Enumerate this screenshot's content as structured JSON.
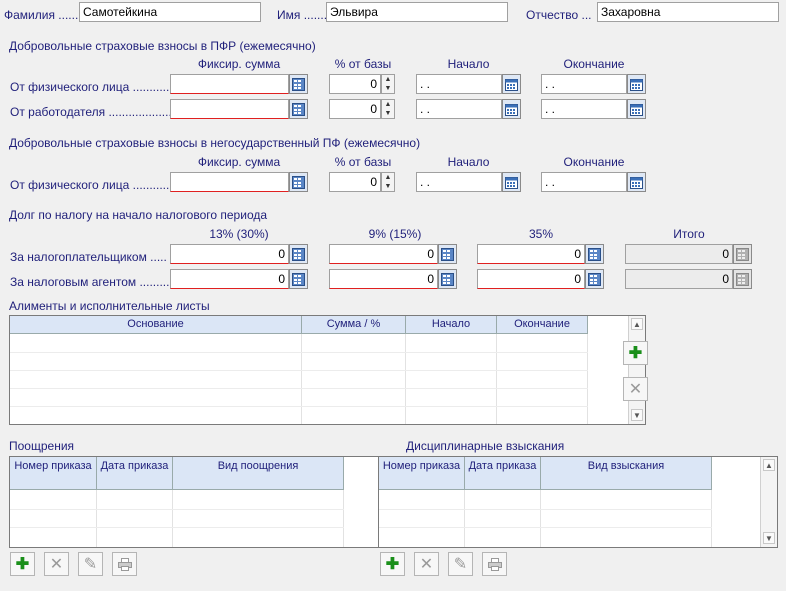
{
  "person": {
    "surname_label": "Фамилия",
    "surname_value": "Самотейкина",
    "name_label": "Имя",
    "name_value": "Эльвира",
    "patronymic_label": "Отчество",
    "patronymic_value": "Захаровна"
  },
  "pfr": {
    "title": "Добровольные страховые взносы в ПФР (ежемесячно)",
    "col_fixed": "Фиксир. сумма",
    "col_percent": "% от базы",
    "col_start": "Начало",
    "col_end": "Окончание",
    "row1_label": "От физического лица",
    "row2_label": "От работодателя",
    "row1_percent": "0",
    "row2_percent": "0",
    "date_placeholder": " .  ."
  },
  "npf": {
    "title": "Добровольные страховые взносы в негосударственный ПФ (ежемесячно)",
    "col_fixed": "Фиксир. сумма",
    "col_percent": "% от базы",
    "col_start": "Начало",
    "col_end": "Окончание",
    "row1_label": "От физического лица",
    "row1_percent": "0",
    "date_placeholder": " .  ."
  },
  "debt": {
    "title": "Долг по налогу на начало налогового периода",
    "col1": "13% (30%)",
    "col2": "9% (15%)",
    "col3": "35%",
    "col4": "Итого",
    "row1_label": "За налогоплательщиком",
    "row2_label": "За налоговым агентом",
    "row1_values": [
      "0",
      "0",
      "0",
      "0"
    ],
    "row2_values": [
      "0",
      "0",
      "0",
      "0"
    ]
  },
  "alimony": {
    "title": "Алименты и исполнительные листы",
    "columns": [
      "Основание",
      "Сумма / %",
      "Начало",
      "Окончание"
    ]
  },
  "rewards": {
    "title": "Поощрения",
    "columns": [
      "Номер приказа",
      "Дата приказа",
      "Вид поощрения"
    ]
  },
  "penalties": {
    "title": "Дисциплинарные взыскания",
    "columns": [
      "Номер приказа",
      "Дата приказа",
      "Вид взыскания"
    ]
  },
  "icons": {
    "calendar": "calendar-icon",
    "add": "plus-icon",
    "delete": "close-icon",
    "edit": "pencil-icon",
    "print": "printer-icon"
  },
  "colors": {
    "label": "#1f1f7a",
    "required_underline": "#e02020",
    "add_green": "#1a8f1a",
    "header_bg": "#dbe6f6"
  }
}
